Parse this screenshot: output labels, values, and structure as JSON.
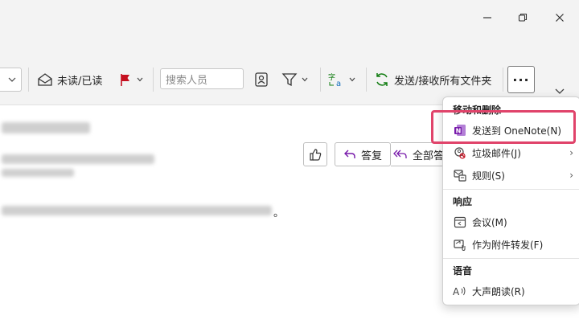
{
  "window": {
    "minimize": "",
    "restore": "⧉",
    "close": "✕"
  },
  "ribbon": {
    "read_toggle": "未读/已读",
    "search_people_placeholder": "搜索人员",
    "send_receive": "发送/接收所有文件夹",
    "more": "···"
  },
  "message": {
    "reply": "答复",
    "reply_all": "全部答",
    "trailing_mark": "。"
  },
  "menu": {
    "section_move_delete": "移动和删除",
    "send_to_onenote": "发送到 OneNote(N)",
    "junk": "垃圾邮件(J)",
    "rules": "规则(S)",
    "section_respond": "响应",
    "meeting": "会议(M)",
    "forward_attachment": "作为附件转发(F)",
    "section_speech": "语音",
    "read_aloud": "大声朗读(R)"
  },
  "colors": {
    "accent": "#0f6cbd",
    "highlight": "#e0436a",
    "onenote": "#7719aa",
    "flag": "#c50f1f"
  }
}
